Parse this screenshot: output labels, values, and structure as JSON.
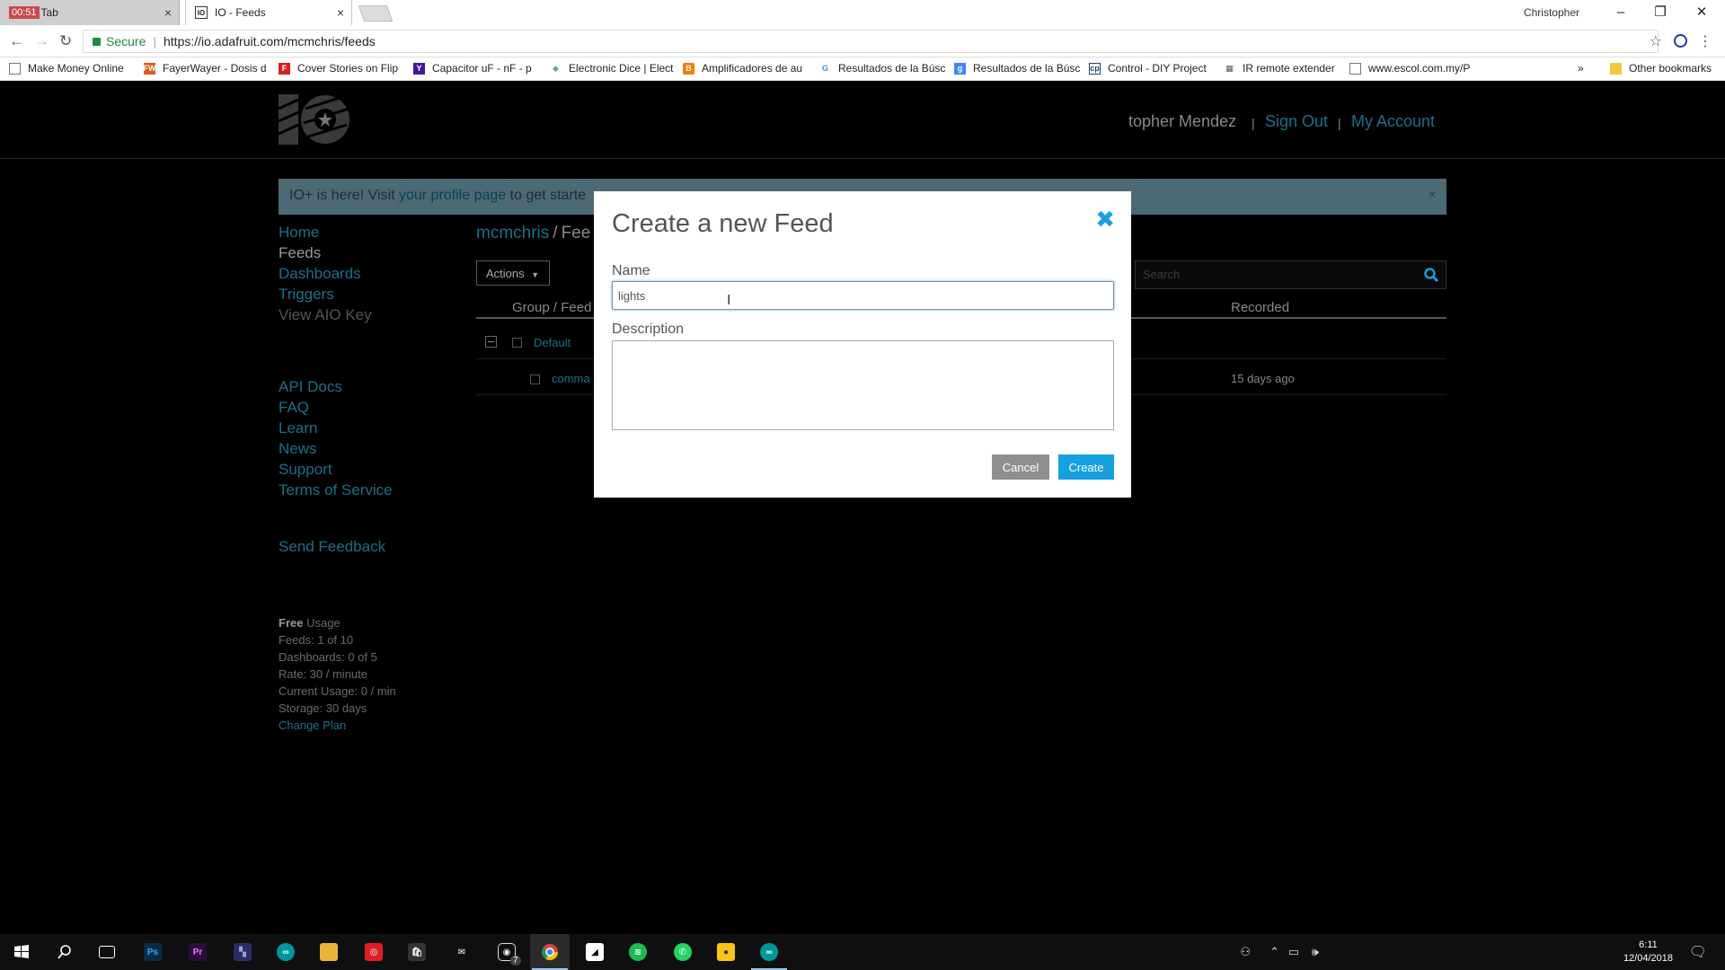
{
  "browser": {
    "tabs": [
      {
        "label": "Tab",
        "timer": "00:51"
      },
      {
        "label": "IO - Feeds"
      }
    ],
    "profile": "Christopher",
    "secure_label": "Secure",
    "url": "https://io.adafruit.com/mcmchris/feeds",
    "bookmarks": [
      "Make Money Online",
      "FayerWayer - Dosis d",
      "Cover Stories on Flip",
      "Capacitor uF - nF - p",
      "Electronic Dice | Elect",
      "Amplificadores de au",
      "Resultados de la Búsc",
      "Resultados de la Búsc",
      "Control - DIY Project",
      "IR remote extender",
      "www.escol.com.my/P"
    ],
    "more_bookmarks": "»",
    "other_bookmarks": "Other bookmarks"
  },
  "header": {
    "user": "topher Mendez",
    "sign_out": "Sign Out",
    "my_account": "My Account",
    "sep": "|"
  },
  "announce": {
    "text_before": "IO+ is here! Visit ",
    "link": "your profile page",
    "text_after": " to get starte",
    "close": "×"
  },
  "sidebar": {
    "nav": [
      "Home",
      "Feeds",
      "Dashboards",
      "Triggers",
      "View AIO Key"
    ],
    "links": [
      "API Docs",
      "FAQ",
      "Learn",
      "News",
      "Support",
      "Terms of Service"
    ],
    "feedback": "Send Feedback",
    "usage": {
      "plan": "Free",
      "plan_suffix": " Usage",
      "lines": [
        "Feeds: 1 of 10",
        "Dashboards: 0 of 5",
        "Rate: 30 / minute",
        "Current Usage: 0 / min",
        "Storage: 30 days"
      ],
      "change_plan": "Change Plan"
    }
  },
  "main": {
    "crumb_user": "mcmchris",
    "crumb_sep": "/",
    "crumb_page": "Fee",
    "actions": "Actions",
    "search_placeholder": "Search",
    "columns": {
      "group": "Group / Feed",
      "recorded": "Recorded"
    },
    "rows": [
      {
        "name": "Default",
        "recorded": ""
      },
      {
        "name": "comma",
        "recorded": "15 days ago"
      }
    ]
  },
  "modal": {
    "title": "Create a new Feed",
    "name_label": "Name",
    "name_value": "lights",
    "description_label": "Description",
    "description_value": "",
    "cancel": "Cancel",
    "create": "Create",
    "close": "✖"
  },
  "taskbar": {
    "time": "6:11",
    "date": "12/04/2018",
    "badge": "7"
  },
  "colors": {
    "accent": "#17a0e0",
    "link": "#1b6f8c",
    "secure": "#1e8e3e"
  }
}
